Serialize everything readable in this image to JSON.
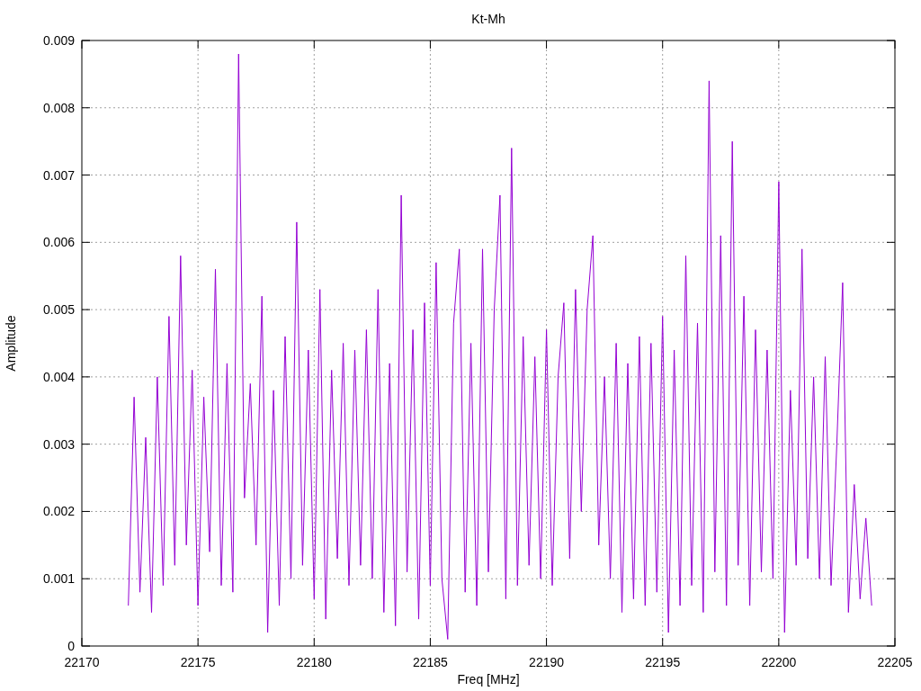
{
  "chart_data": {
    "type": "line",
    "title": "Kt-Mh",
    "xlabel": "Freq [MHz]",
    "ylabel": "Amplitude",
    "grid": true,
    "xlim": [
      22170,
      22205
    ],
    "ylim": [
      0,
      0.009
    ],
    "xticks": [
      22170,
      22175,
      22180,
      22185,
      22190,
      22195,
      22200,
      22205
    ],
    "yticks": [
      {
        "value": 0,
        "label": "0"
      },
      {
        "value": 0.001,
        "label": "0.001"
      },
      {
        "value": 0.002,
        "label": "0.002"
      },
      {
        "value": 0.003,
        "label": "0.003"
      },
      {
        "value": 0.004,
        "label": "0.004"
      },
      {
        "value": 0.005,
        "label": "0.005"
      },
      {
        "value": 0.006,
        "label": "0.006"
      },
      {
        "value": 0.007,
        "label": "0.007"
      },
      {
        "value": 0.008,
        "label": "0.008"
      },
      {
        "value": 0.009,
        "label": "0.009"
      }
    ],
    "x": [
      22172,
      22172.25,
      22172.5,
      22172.75,
      22173,
      22173.25,
      22173.5,
      22173.75,
      22174,
      22174.25,
      22174.5,
      22174.75,
      22175,
      22175.25,
      22175.5,
      22175.75,
      22176,
      22176.25,
      22176.5,
      22176.75,
      22177,
      22177.25,
      22177.5,
      22177.75,
      22178,
      22178.25,
      22178.5,
      22178.75,
      22179,
      22179.25,
      22179.5,
      22179.75,
      22180,
      22180.25,
      22180.5,
      22180.75,
      22181,
      22181.25,
      22181.5,
      22181.75,
      22182,
      22182.25,
      22182.5,
      22182.75,
      22183,
      22183.25,
      22183.5,
      22183.75,
      22184,
      22184.25,
      22184.5,
      22184.75,
      22185,
      22185.25,
      22185.5,
      22185.75,
      22186,
      22186.25,
      22186.5,
      22186.75,
      22187,
      22187.25,
      22187.5,
      22187.75,
      22188,
      22188.25,
      22188.5,
      22188.75,
      22189,
      22189.25,
      22189.5,
      22189.75,
      22190,
      22190.25,
      22190.5,
      22190.75,
      22191,
      22191.25,
      22191.5,
      22191.75,
      22192,
      22192.25,
      22192.5,
      22192.75,
      22193,
      22193.25,
      22193.5,
      22193.75,
      22194,
      22194.25,
      22194.5,
      22194.75,
      22195,
      22195.25,
      22195.5,
      22195.75,
      22196,
      22196.25,
      22196.5,
      22196.75,
      22197,
      22197.25,
      22197.5,
      22197.75,
      22198,
      22198.25,
      22198.5,
      22198.75,
      22199,
      22199.25,
      22199.5,
      22199.75,
      22200,
      22200.25,
      22200.5,
      22200.75,
      22201,
      22201.25,
      22201.5,
      22201.75,
      22202,
      22202.25,
      22202.5,
      22202.75,
      22203,
      22203.25,
      22203.5,
      22203.75,
      22204
    ],
    "series": [
      {
        "color": "#9400d3",
        "values": [
          0.0006,
          0.0037,
          0.0008,
          0.0031,
          0.0005,
          0.004,
          0.0009,
          0.0049,
          0.0012,
          0.0058,
          0.0015,
          0.0041,
          0.0006,
          0.0037,
          0.0014,
          0.0056,
          0.0009,
          0.0042,
          0.0008,
          0.0088,
          0.0022,
          0.0039,
          0.0015,
          0.0052,
          0.0002,
          0.0038,
          0.0006,
          0.0046,
          0.001,
          0.0063,
          0.0012,
          0.0044,
          0.0007,
          0.0053,
          0.0004,
          0.0041,
          0.0013,
          0.0045,
          0.0009,
          0.0044,
          0.0012,
          0.0047,
          0.001,
          0.0053,
          0.0005,
          0.0042,
          0.0003,
          0.0067,
          0.0011,
          0.0047,
          0.0004,
          0.0051,
          0.0009,
          0.0057,
          0.001,
          0.0001,
          0.0048,
          0.0059,
          0.0008,
          0.0045,
          0.0006,
          0.0059,
          0.0011,
          0.005,
          0.0067,
          0.0007,
          0.0074,
          0.0009,
          0.0046,
          0.0012,
          0.0043,
          0.001,
          0.0047,
          0.0009,
          0.004,
          0.0051,
          0.0013,
          0.0053,
          0.002,
          0.005,
          0.0061,
          0.0015,
          0.004,
          0.001,
          0.0045,
          0.0005,
          0.0042,
          0.0007,
          0.0046,
          0.0006,
          0.0045,
          0.0008,
          0.0049,
          0.0002,
          0.0044,
          0.0006,
          0.0058,
          0.0009,
          0.0048,
          0.0005,
          0.0084,
          0.0011,
          0.0061,
          0.0006,
          0.0075,
          0.0012,
          0.0052,
          0.0006,
          0.0047,
          0.0011,
          0.0044,
          0.001,
          0.0069,
          0.0002,
          0.0038,
          0.0012,
          0.0059,
          0.0013,
          0.004,
          0.001,
          0.0043,
          0.0009,
          0.003,
          0.0054,
          0.0005,
          0.0024,
          0.0007,
          0.0019,
          0.0006
        ]
      }
    ]
  }
}
